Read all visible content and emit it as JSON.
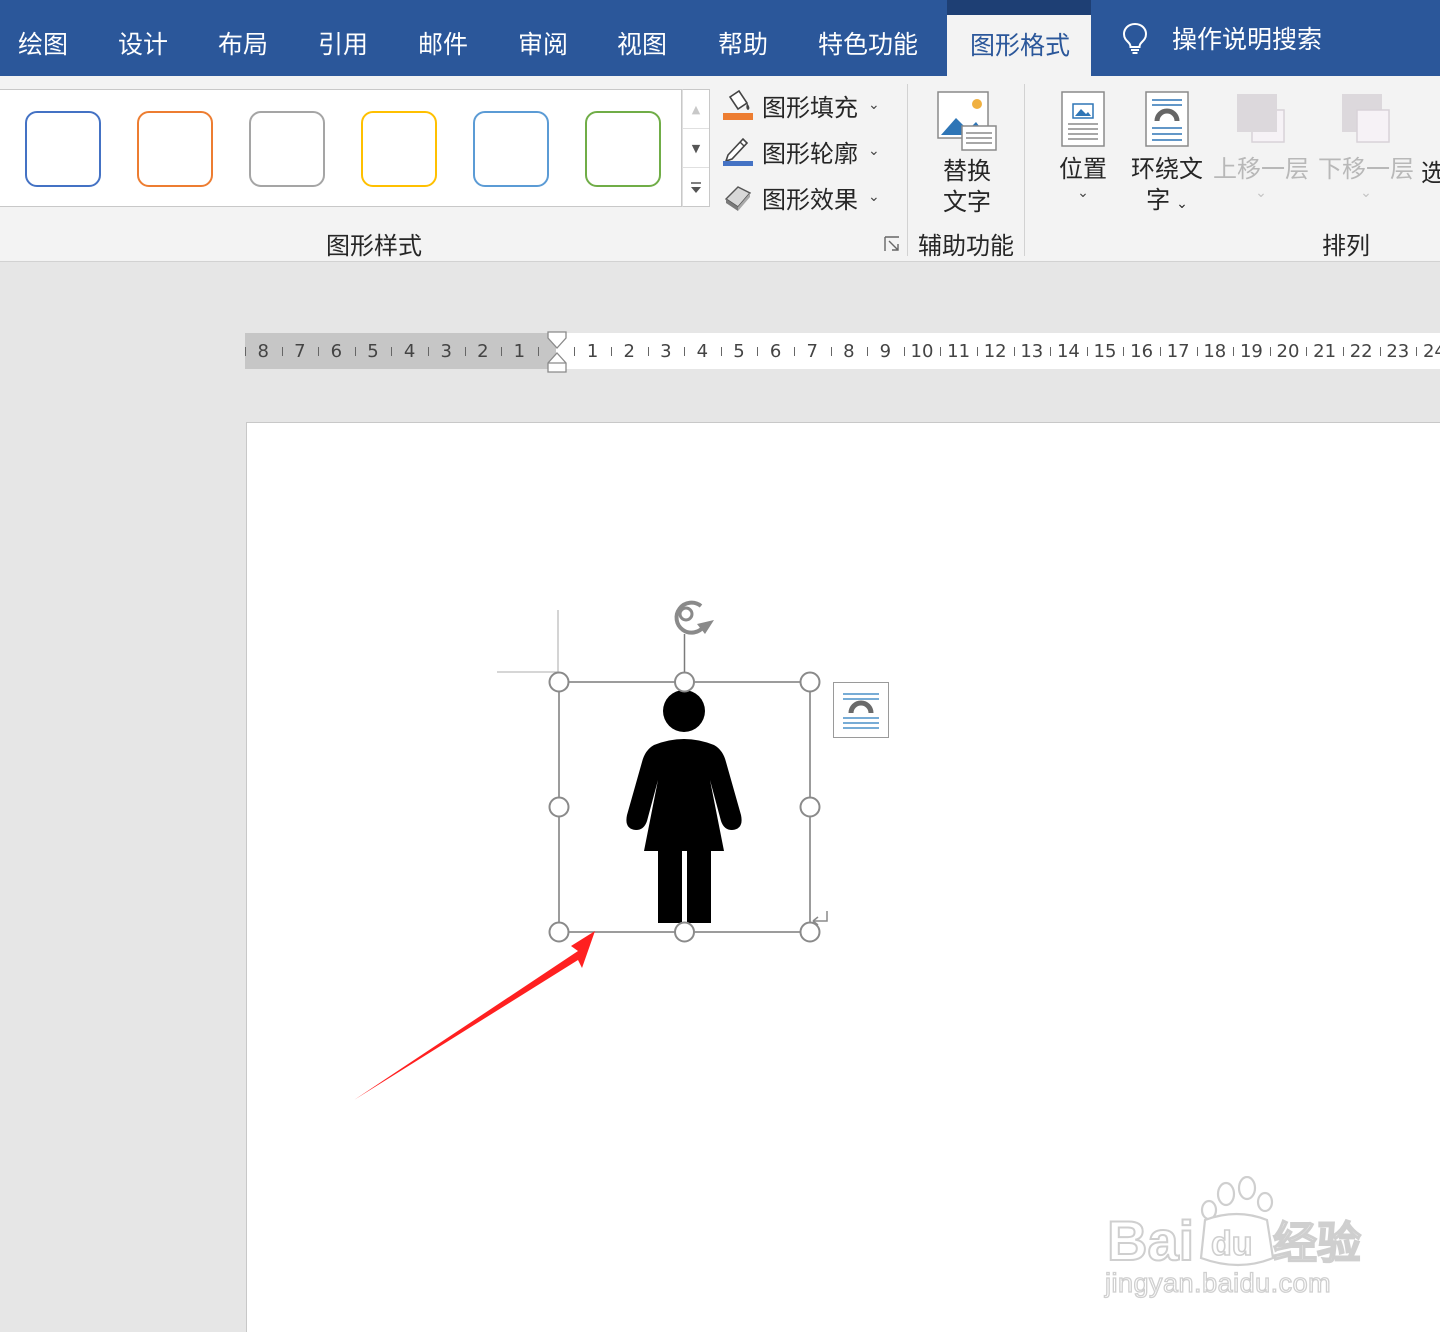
{
  "ribbon": {
    "tabs": [
      {
        "label": "绘图"
      },
      {
        "label": "设计"
      },
      {
        "label": "布局"
      },
      {
        "label": "引用"
      },
      {
        "label": "邮件"
      },
      {
        "label": "审阅"
      },
      {
        "label": "视图"
      },
      {
        "label": "帮助"
      },
      {
        "label": "特色功能"
      },
      {
        "label": "图形格式",
        "active": true
      }
    ],
    "tell_me": "操作说明搜索",
    "shape_styles": {
      "group_label": "图形样式",
      "swatch_colors": [
        "#4472c4",
        "#ed7d31",
        "#a5a5a5",
        "#ffc000",
        "#5b9bd5",
        "#70ad47"
      ],
      "fill": "图形填充",
      "outline": "图形轮廓",
      "effects": "图形效果"
    },
    "accessibility": {
      "group_label": "辅助功能",
      "alt_text_line1": "替换",
      "alt_text_line2": "文字"
    },
    "arrange": {
      "group_label": "排列",
      "position": "位置",
      "wrap_text_line1": "环绕文",
      "wrap_text_line2": "字",
      "bring_forward": "上移一层",
      "send_backward": "下移一层",
      "selection_pane_partial": "选"
    }
  },
  "ruler": {
    "left_numbers": [
      "8",
      "7",
      "6",
      "5",
      "4",
      "3",
      "2",
      "1"
    ],
    "right_numbers": [
      "1",
      "2",
      "3",
      "4",
      "5",
      "6",
      "7",
      "8",
      "9",
      "10",
      "11",
      "12",
      "13",
      "14",
      "15",
      "16",
      "17",
      "18",
      "19",
      "20",
      "21",
      "22",
      "23",
      "24"
    ]
  },
  "document": {
    "selected_object": "female-figure-icon",
    "annotation_arrow_color": "#ff2020"
  },
  "watermark": {
    "brand_latin": "Bai",
    "brand_du": "du",
    "brand_cn": "经验",
    "url": "jingyan.baidu.com"
  },
  "colors": {
    "ribbon_blue": "#2b579a",
    "ribbon_bg": "#f3f3f3",
    "canvas_bg": "#e6e6e6"
  }
}
